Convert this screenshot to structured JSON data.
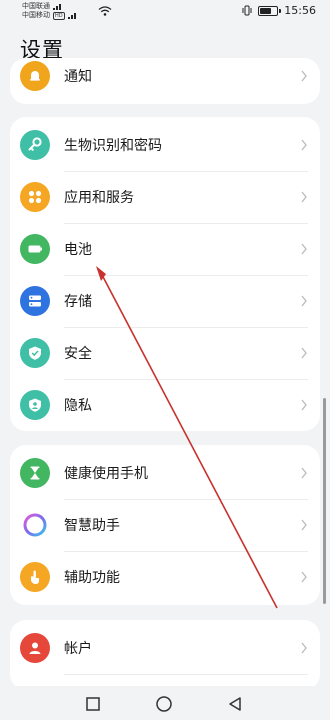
{
  "status_bar": {
    "carrier1": "中国联通",
    "carrier2": "中国移动",
    "hd_badge": "HD",
    "time": "15:56",
    "battery_level": 0.7
  },
  "page_title": "设置",
  "partial_item": {
    "label": "通知",
    "icon": "bell-icon",
    "color": "#f0a51c"
  },
  "groups": [
    {
      "items": [
        {
          "label": "生物识别和密码",
          "icon": "key-icon",
          "color": "#3fbfa5"
        },
        {
          "label": "应用和服务",
          "icon": "apps-grid-icon",
          "color": "#f5a623"
        },
        {
          "label": "电池",
          "icon": "battery-icon",
          "color": "#42b660"
        },
        {
          "label": "存储",
          "icon": "storage-icon",
          "color": "#2f73e0"
        },
        {
          "label": "安全",
          "icon": "shield-icon",
          "color": "#3fbfa5"
        },
        {
          "label": "隐私",
          "icon": "privacy-icon",
          "color": "#3fbfa5"
        }
      ]
    },
    {
      "items": [
        {
          "label": "健康使用手机",
          "icon": "hourglass-icon",
          "color": "#42b660"
        },
        {
          "label": "智慧助手",
          "icon": "assistant-ring-icon",
          "color": "#7b6cf0"
        },
        {
          "label": "辅助功能",
          "icon": "hand-icon",
          "color": "#f5a623"
        }
      ]
    },
    {
      "items": [
        {
          "label": "帐户",
          "icon": "user-icon",
          "color": "#e5473b"
        }
      ]
    }
  ],
  "nav": {
    "back": "back-icon",
    "home": "home-icon",
    "recents": "recents-icon"
  },
  "annotation": {
    "color": "#c8322e"
  }
}
